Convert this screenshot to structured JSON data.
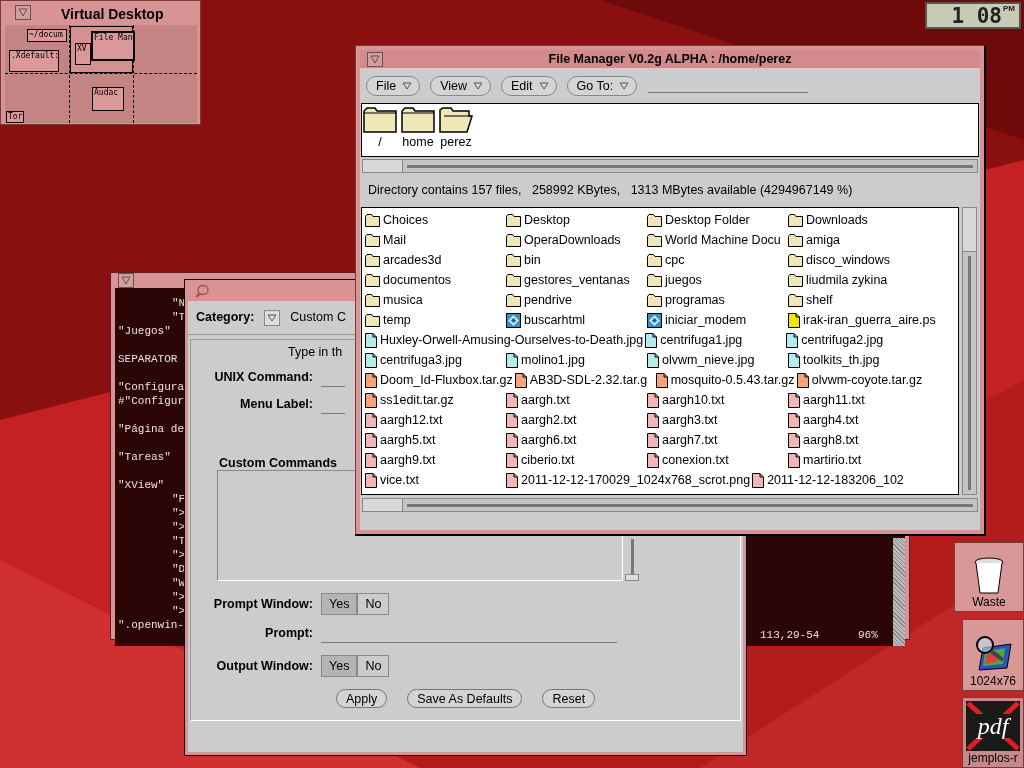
{
  "virtual_desktop": {
    "title": "Virtual Desktop",
    "windows": [
      {
        "label": "~/docum"
      },
      {
        "label": ".Xdefault:"
      },
      {
        "label": "XV"
      },
      {
        "label": "File Man"
      },
      {
        "label": "Audac"
      },
      {
        "label": "Tor"
      }
    ]
  },
  "clock": {
    "time": "1 08",
    "meridiem": "PM"
  },
  "terminal": {
    "blocks": [
      {
        "lines": [
          {
            "text": "\"N",
            "indented": true
          },
          {
            "text": "\"T",
            "indented": true
          },
          {
            "text": "\"Juegos\"",
            "indented": false
          }
        ]
      },
      {
        "lines": [
          {
            "text": "SEPARATOR",
            "indented": false
          }
        ]
      },
      {
        "lines": [
          {
            "text": "\"Configura",
            "indented": false
          },
          {
            "text": "#\"Configur",
            "indented": false
          }
        ]
      },
      {
        "lines": [
          {
            "text": "\"Página de",
            "indented": false
          }
        ]
      },
      {
        "lines": [
          {
            "text": "\"Tareas\"",
            "indented": false
          }
        ]
      },
      {
        "lines": [
          {
            "text": "\"XView\"",
            "indented": false
          },
          {
            "text": "\"F",
            "indented": true
          },
          {
            "text": "\">",
            "indented": true
          },
          {
            "text": "\">",
            "indented": true
          },
          {
            "text": "\"T",
            "indented": true
          },
          {
            "text": "\">",
            "indented": true
          },
          {
            "text": "\"D",
            "indented": true
          },
          {
            "text": "\"W",
            "indented": true
          },
          {
            "text": "\">",
            "indented": true
          },
          {
            "text": "\">",
            "indented": true
          },
          {
            "text": "\".openwin-",
            "indented": false
          }
        ]
      }
    ],
    "status_position": "113,29-54",
    "status_percent": "96%"
  },
  "custom_commands_dialog": {
    "category_label": "Category:",
    "category_value": "Custom C",
    "instruction": "Type in th",
    "fields": [
      {
        "label": "UNIX Command:"
      },
      {
        "label": "Menu Label:"
      }
    ],
    "list_label": "Custom Commands",
    "prompt_window": {
      "label": "Prompt Window:",
      "options": [
        {
          "label": "Yes",
          "selected": true
        },
        {
          "label": "No",
          "selected": false
        }
      ]
    },
    "prompt": {
      "label": "Prompt:"
    },
    "output_window": {
      "label": "Output Window:",
      "options": [
        {
          "label": "Yes",
          "selected": true
        },
        {
          "label": "No",
          "selected": false
        }
      ]
    },
    "buttons": [
      "Apply",
      "Save As Defaults",
      "Reset"
    ]
  },
  "file_manager": {
    "title": "File Manager V0.2g ALPHA : /home/perez",
    "menus": [
      "File",
      "View",
      "Edit",
      "Go To:"
    ],
    "path": [
      {
        "label": "/",
        "open": false
      },
      {
        "label": "home",
        "open": false
      },
      {
        "label": "perez",
        "open": true
      }
    ],
    "status": "Directory contains 157 files,   258992 KBytes,   1313 MBytes available (4294967149 %)",
    "rows": [
      [
        {
          "name": "Choices",
          "kind": "folder"
        },
        {
          "name": "Desktop",
          "kind": "folder"
        },
        {
          "name": "Desktop Folder",
          "kind": "folder"
        },
        {
          "name": "Downloads",
          "kind": "folder"
        }
      ],
      [
        {
          "name": "Mail",
          "kind": "folder"
        },
        {
          "name": "OperaDownloads",
          "kind": "folder"
        },
        {
          "name": "World Machine Docu",
          "kind": "folder"
        },
        {
          "name": "amiga",
          "kind": "folder"
        }
      ],
      [
        {
          "name": "arcades3d",
          "kind": "folder"
        },
        {
          "name": "bin",
          "kind": "folder"
        },
        {
          "name": "cpc",
          "kind": "folder"
        },
        {
          "name": "disco_windows",
          "kind": "folder"
        }
      ],
      [
        {
          "name": "documentos",
          "kind": "folder"
        },
        {
          "name": "gestores_ventanas",
          "kind": "folder"
        },
        {
          "name": "juegos",
          "kind": "folder"
        },
        {
          "name": "liudmila zykina",
          "kind": "folder"
        }
      ],
      [
        {
          "name": "musica",
          "kind": "folder"
        },
        {
          "name": "pendrive",
          "kind": "folder"
        },
        {
          "name": "programas",
          "kind": "folder"
        },
        {
          "name": "shelf",
          "kind": "folder"
        }
      ],
      [
        {
          "name": "temp",
          "kind": "folder"
        },
        {
          "name": "buscarhtml",
          "kind": "program"
        },
        {
          "name": "iniciar_modem",
          "kind": "program"
        },
        {
          "name": "irak-iran_guerra_aire.ps",
          "kind": "postscript"
        }
      ],
      [
        {
          "name": "Huxley-Orwell-Amusing-Ourselves-to-Death.jpg",
          "kind": "image"
        },
        {
          "name": "centrifuga1.jpg",
          "kind": "image"
        },
        {
          "name": "centrifuga2.jpg",
          "kind": "image"
        }
      ],
      [
        {
          "name": "centrifuga3.jpg",
          "kind": "image"
        },
        {
          "name": "molino1.jpg",
          "kind": "image"
        },
        {
          "name": "olvwm_nieve.jpg",
          "kind": "image"
        },
        {
          "name": "toolkits_th.jpg",
          "kind": "image"
        }
      ],
      [
        {
          "name": "Doom_Id-Fluxbox.tar.gz",
          "kind": "archive"
        },
        {
          "name": "AB3D-SDL-2.32.tar.g",
          "kind": "archive"
        },
        {
          "name": "mosquito-0.5.43.tar.gz",
          "kind": "archive"
        },
        {
          "name": "olvwm-coyote.tar.gz",
          "kind": "archive"
        }
      ],
      [
        {
          "name": "ss1edit.tar.gz",
          "kind": "archive"
        },
        {
          "name": "aargh.txt",
          "kind": "text"
        },
        {
          "name": "aargh10.txt",
          "kind": "text"
        },
        {
          "name": "aargh11.txt",
          "kind": "text"
        }
      ],
      [
        {
          "name": "aargh12.txt",
          "kind": "text"
        },
        {
          "name": "aargh2.txt",
          "kind": "text"
        },
        {
          "name": "aargh3.txt",
          "kind": "text"
        },
        {
          "name": "aargh4.txt",
          "kind": "text"
        }
      ],
      [
        {
          "name": "aargh5.txt",
          "kind": "text"
        },
        {
          "name": "aargh6.txt",
          "kind": "text"
        },
        {
          "name": "aargh7.txt",
          "kind": "text"
        },
        {
          "name": "aargh8.txt",
          "kind": "text"
        }
      ],
      [
        {
          "name": "aargh9.txt",
          "kind": "text"
        },
        {
          "name": "ciberio.txt",
          "kind": "text"
        },
        {
          "name": "conexion.txt",
          "kind": "text"
        },
        {
          "name": "martirio.txt",
          "kind": "text"
        }
      ],
      [
        {
          "name": "vice.txt",
          "kind": "text"
        },
        {
          "name": "2011-12-12-170029_1024x768_scrot.png",
          "kind": "text"
        },
        {
          "name": "2011-12-12-183206_102",
          "kind": "text"
        }
      ]
    ]
  },
  "desktop_icons": [
    {
      "label": "Waste",
      "kind": "trash"
    },
    {
      "label": "1024x76",
      "kind": "image_viewer"
    },
    {
      "label": "jemplos-r",
      "kind": "pdf",
      "icon_text": "pdf"
    }
  ]
}
